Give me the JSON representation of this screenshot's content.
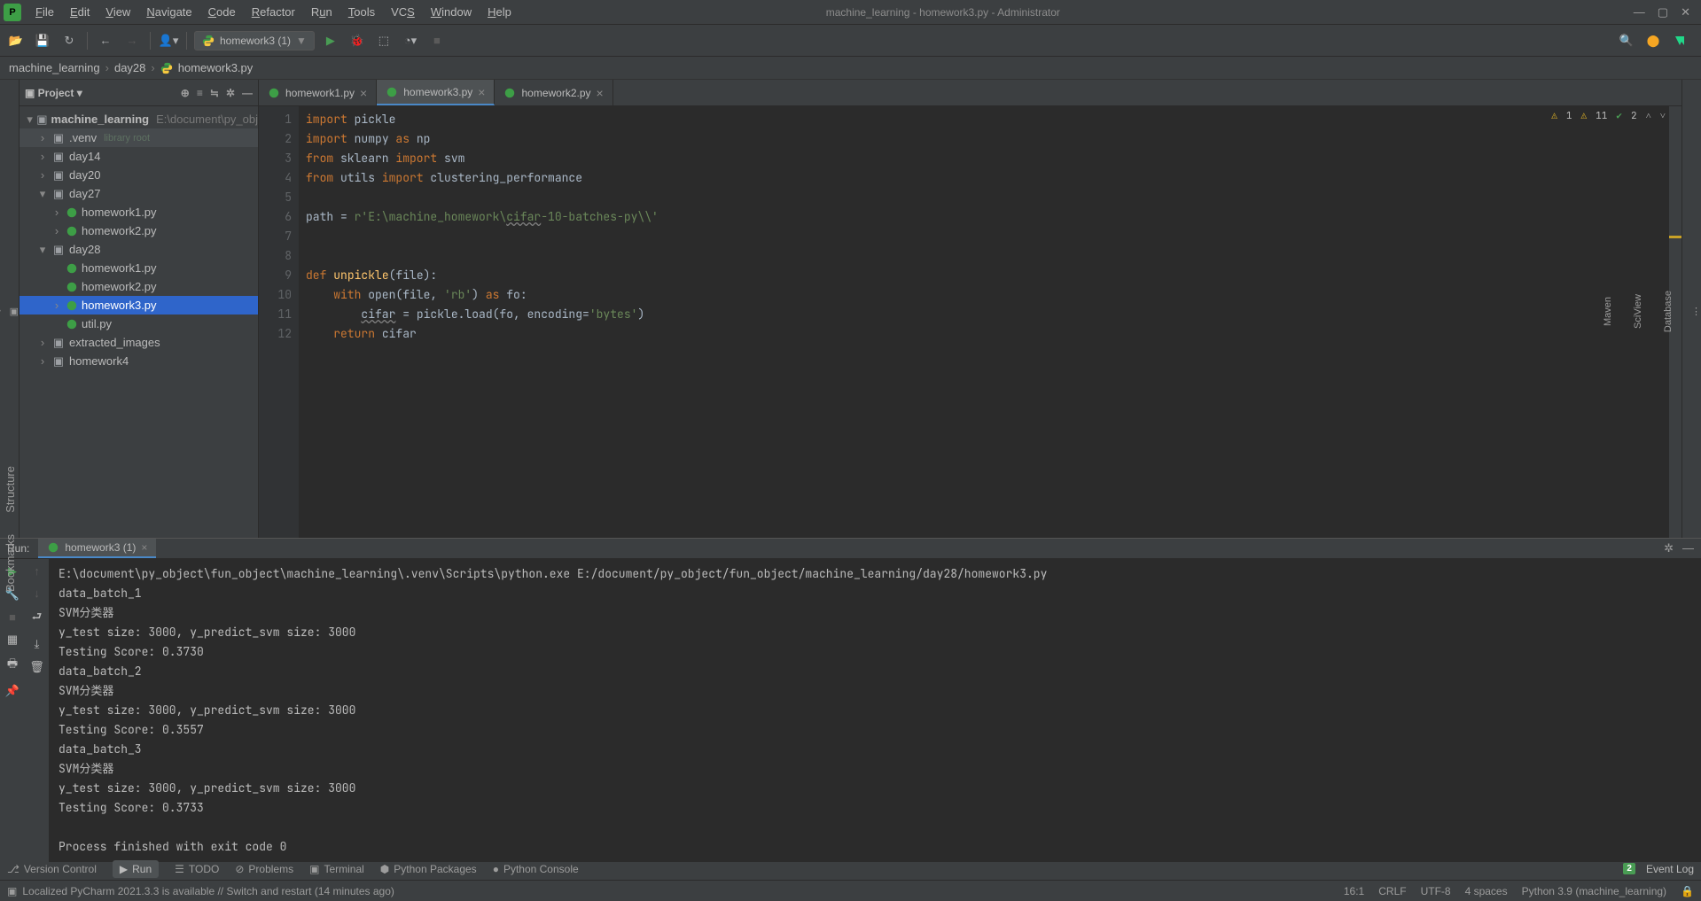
{
  "window": {
    "title": "machine_learning - homework3.py - Administrator"
  },
  "menubar": [
    "File",
    "Edit",
    "View",
    "Navigate",
    "Code",
    "Refactor",
    "Run",
    "Tools",
    "VCS",
    "Window",
    "Help"
  ],
  "menubar_underline": [
    "F",
    "E",
    "V",
    "N",
    "C",
    "R",
    "u",
    "T",
    "S",
    "W",
    "H"
  ],
  "toolbar": {
    "run_config": "homework3 (1)"
  },
  "breadcrumb": {
    "root": "machine_learning",
    "folder": "day28",
    "file": "homework3.py"
  },
  "project": {
    "panel_label": "Project",
    "root": "machine_learning",
    "root_path": "E:\\document\\py_obj",
    "venv": ".venv",
    "library_root": "library root",
    "folders": [
      "day14",
      "day20",
      "day27",
      "day28",
      "extracted_images",
      "homework4"
    ],
    "day27_files": [
      "homework1.py",
      "homework2.py"
    ],
    "day28_files": [
      "homework1.py",
      "homework2.py",
      "homework3.py",
      "util.py"
    ]
  },
  "tabs": [
    "homework1.py",
    "homework3.py",
    "homework2.py"
  ],
  "active_tab": 1,
  "editor_status": {
    "weak_warn": "1",
    "warn": "11",
    "ok": "2"
  },
  "code_lines": [
    {
      "n": 1,
      "html": "<span class='kw'>import</span> pickle"
    },
    {
      "n": 2,
      "html": "<span class='kw'>import</span> numpy <span class='kw'>as</span> np"
    },
    {
      "n": 3,
      "html": "<span class='kw'>from</span> sklearn <span class='kw'>import</span> svm"
    },
    {
      "n": 4,
      "html": "<span class='kw'>from</span> utils <span class='kw'>import</span> clustering_performance"
    },
    {
      "n": 5,
      "html": ""
    },
    {
      "n": 6,
      "html": "path = <span class='str'>r'E:\\machine_homework\\</span><span class='str underline'>cifar</span><span class='str'>-10-batches-py\\\\'</span>"
    },
    {
      "n": 7,
      "html": ""
    },
    {
      "n": 8,
      "html": ""
    },
    {
      "n": 9,
      "html": "<span class='kw'>def</span> <span class='fn'>unpickle</span>(file):"
    },
    {
      "n": 10,
      "html": "    <span class='kw'>with</span> open(file, <span class='str'>'rb'</span>) <span class='kw'>as</span> fo:"
    },
    {
      "n": 11,
      "html": "        <span class='underline'>cifar</span> = pickle.load(fo, encoding=<span class='str'>'bytes'</span>)"
    },
    {
      "n": 12,
      "html": "    <span class='kw'>return</span> cifar"
    }
  ],
  "run": {
    "label": "Run:",
    "tab": "homework3 (1)",
    "output": [
      "E:\\document\\py_object\\fun_object\\machine_learning\\.venv\\Scripts\\python.exe E:/document/py_object/fun_object/machine_learning/day28/homework3.py",
      "data_batch_1",
      "SVM分类器",
      "y_test size: 3000, y_predict_svm size: 3000",
      "Testing Score: 0.3730",
      "data_batch_2",
      "SVM分类器",
      "y_test size: 3000, y_predict_svm size: 3000",
      "Testing Score: 0.3557",
      "data_batch_3",
      "SVM分类器",
      "y_test size: 3000, y_predict_svm size: 3000",
      "Testing Score: 0.3733",
      "",
      "Process finished with exit code 0",
      ""
    ]
  },
  "bottom_tabs": [
    "Version Control",
    "Run",
    "TODO",
    "Problems",
    "Terminal",
    "Python Packages",
    "Python Console"
  ],
  "bottom_right": {
    "event_log": "Event Log",
    "notif": "2"
  },
  "statusbar": {
    "msg": "Localized PyCharm 2021.3.3 is available // Switch and restart (14 minutes ago)",
    "pos": "16:1",
    "eol": "CRLF",
    "enc": "UTF-8",
    "indent": "4 spaces",
    "interp": "Python 3.9 (machine_learning)"
  },
  "left_tabs": [
    "Structure",
    "Bookmarks"
  ],
  "right_tabs": [
    "Database",
    "SciView",
    "Maven"
  ]
}
